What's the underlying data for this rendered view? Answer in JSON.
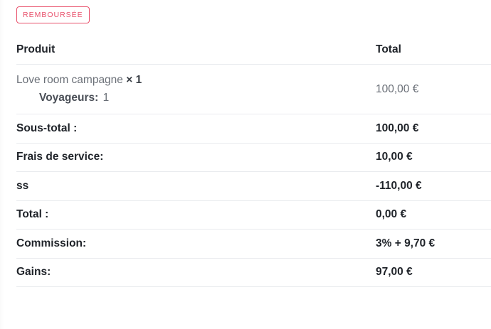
{
  "status_badge": "REMBOURSÉE",
  "table": {
    "header": {
      "product_label": "Produit",
      "total_label": "Total"
    },
    "product": {
      "name": "Love room campagne",
      "quantity": "× 1",
      "meta_label": "Voyageurs:",
      "meta_value": "1",
      "total": "100,00 €"
    },
    "summary": [
      {
        "label": "Sous-total :",
        "value": "100,00 €"
      },
      {
        "label": "Frais de service:",
        "value": "10,00 €"
      },
      {
        "label": "ss",
        "value": "-110,00 €"
      },
      {
        "label": "Total :",
        "value": "0,00 €"
      },
      {
        "label": "Commission:",
        "value": "3% + 9,70 €"
      },
      {
        "label": "Gains:",
        "value": "97,00 €"
      }
    ]
  },
  "colors": {
    "badge": "#e8506b",
    "divider": "#e9ebee",
    "text_dark": "#1f2329",
    "text_muted": "#6a6f77"
  }
}
